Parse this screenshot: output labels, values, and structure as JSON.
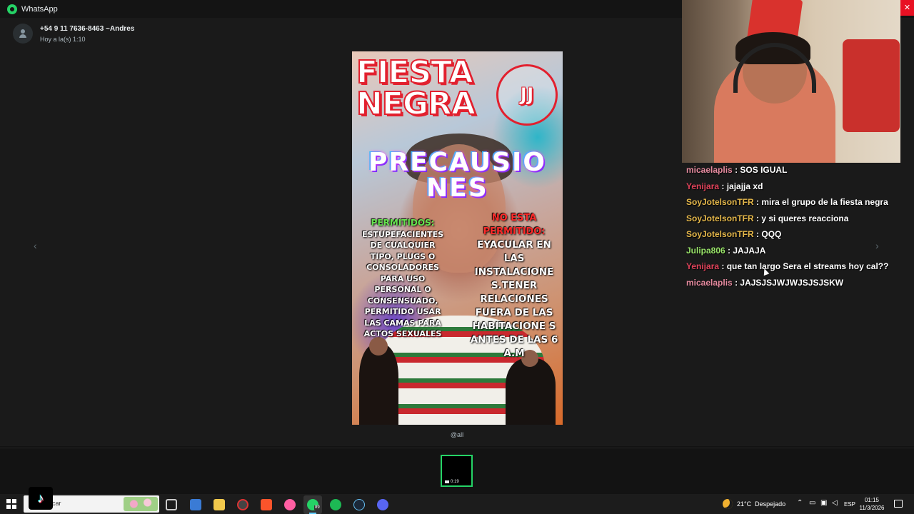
{
  "window": {
    "title": "WhatsApp"
  },
  "viewer": {
    "sender_name": "+54 9 11 7636-8463 ~Andres",
    "sender_time": "Hoy a la(s) 1:10",
    "caption": "@all",
    "prev_arrow": "‹",
    "next_arrow": "›",
    "thumbnail_duration": "0:19"
  },
  "poster": {
    "title_line1": "FIESTA",
    "title_line2": "NEGRA",
    "badge": "JJ",
    "heading_line1": "PRECAUSIO",
    "heading_line2": "NES",
    "allowed_title": "PERMITIDOS:",
    "allowed_text": "ESTUPEFACIENTES DE CUALQUIER TIPO, PLUGS O CONSOLADORES PARA USO PERSONAL O CONSENSUADO, PERMITIDO USAR LAS CAMAS PARA ACTOS SEXUALES",
    "forbidden_title": "NO ESTA PERMITIDO:",
    "forbidden_text": "EYACULAR EN LAS INSTALACIONE S.TENER RELACIONES FUERA DE LAS HABITACIONE S ANTES DE LAS 6 A.M"
  },
  "stream_chat": [
    {
      "user": "micaelaplis",
      "color": "#e78ca0",
      "text": ": SOS IGUAL"
    },
    {
      "user": "Yenijara",
      "color": "#e0435a",
      "text": ": jajajja xd"
    },
    {
      "user": "SoyJotelsonTFR",
      "color": "#e6b84a",
      "text": ": mira el grupo de la fiesta negra"
    },
    {
      "user": "SoyJotelsonTFR",
      "color": "#e6b84a",
      "text": ": y si queres reacciona"
    },
    {
      "user": "SoyJotelsonTFR",
      "color": "#e6b84a",
      "text": ": QQQ"
    },
    {
      "user": "Julipa806",
      "color": "#9ae56a",
      "text": ": JAJAJA"
    },
    {
      "user": "Yenijara",
      "color": "#e0435a",
      "text": ": que tan largo Sera el streams hoy cal??"
    },
    {
      "user": "micaelaplis",
      "color": "#e78ca0",
      "text": ": JAJSJSJWJWJSJSJSKW"
    }
  ],
  "taskbar": {
    "search_placeholder": "car",
    "whatsapp_badge": "89",
    "weather_temp": "21°C",
    "weather_text": "Despejado",
    "language": "ESP",
    "time": "01:15",
    "date": "11/3/2026"
  },
  "colors": {
    "accent_green": "#25d366",
    "close_red": "#e81123"
  }
}
